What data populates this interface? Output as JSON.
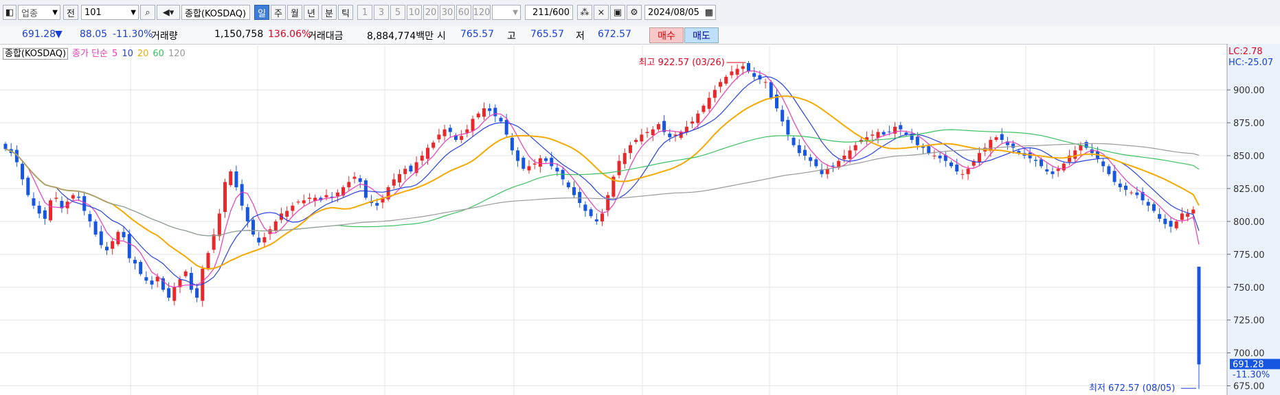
{
  "toolbar": {
    "market_select": "업종",
    "range_label": "전",
    "code_value": "101",
    "index_name": "종합(KOSDAQ)",
    "periods": [
      "일",
      "주",
      "월",
      "년",
      "분",
      "틱"
    ],
    "active_period": "일",
    "minute_units": [
      "1",
      "3",
      "5",
      "10",
      "20",
      "30",
      "60",
      "120"
    ],
    "count_value": "211",
    "count_total": "/600",
    "date_value": "2024/08/05"
  },
  "info": {
    "price": "691.28",
    "change_arrow": "▼",
    "change": "88.05",
    "change_pct": "-11.30%",
    "volume_label": "거래량",
    "volume_value": "1,150,758",
    "volume_ratio": "136.06%",
    "amount_label": "거래대금",
    "amount_value": "8,884,774백만",
    "open_label": "시",
    "open_value": "765.57",
    "high_label": "고",
    "high_value": "765.57",
    "low_label": "저",
    "low_value": "672.57",
    "buy_label": "매수",
    "sell_label": "매도"
  },
  "legend": {
    "name": "종합(KOSDAQ)",
    "ma_label": "종가 단순",
    "ma_periods": [
      "5",
      "10",
      "20",
      "60",
      "120"
    ]
  },
  "colors": {
    "up": "#e8282a",
    "down": "#1756e0",
    "ma5": "#e83ab6",
    "ma10": "#2340e0",
    "ma20": "#f5a800",
    "ma60": "#3cc060",
    "ma120": "#9a9a9a",
    "accent": "#3f7ed8"
  },
  "chart_data": {
    "type": "candlestick",
    "y_ticks": [
      "900.00",
      "875.00",
      "850.00",
      "825.00",
      "800.00",
      "775.00",
      "750.00",
      "725.00",
      "700.00",
      "675.00"
    ],
    "ylim": [
      668,
      935
    ],
    "lc": "LC:2.78",
    "hc": "HC:-25.07",
    "current_price": "691.28",
    "current_pct": "-11.30%",
    "high_annotation": "최고 922.57 (03/26)",
    "low_annotation": "최저 672.57 (08/05)",
    "closes": [
      855,
      852,
      845,
      832,
      820,
      812,
      806,
      802,
      816,
      818,
      810,
      815,
      820,
      818,
      808,
      800,
      790,
      782,
      778,
      785,
      792,
      788,
      772,
      768,
      760,
      755,
      752,
      758,
      748,
      742,
      750,
      756,
      762,
      748,
      742,
      764,
      776,
      790,
      806,
      830,
      838,
      826,
      812,
      800,
      790,
      784,
      788,
      794,
      800,
      806,
      808,
      812,
      815,
      816,
      818,
      818,
      816,
      820,
      818,
      822,
      826,
      830,
      834,
      830,
      818,
      814,
      812,
      818,
      826,
      832,
      836,
      840,
      838,
      845,
      850,
      856,
      860,
      866,
      870,
      868,
      862,
      865,
      870,
      878,
      882,
      886,
      884,
      880,
      876,
      866,
      854,
      846,
      840,
      842,
      844,
      848,
      846,
      842,
      838,
      832,
      826,
      820,
      814,
      808,
      804,
      800,
      806,
      820,
      834,
      846,
      852,
      858,
      862,
      866,
      868,
      870,
      874,
      868,
      864,
      866,
      868,
      872,
      876,
      882,
      888,
      894,
      900,
      906,
      910,
      914,
      916,
      918,
      914,
      910,
      908,
      906,
      894,
      886,
      876,
      866,
      858,
      852,
      850,
      846,
      842,
      836,
      840,
      842,
      846,
      850,
      854,
      858,
      862,
      864,
      866,
      868,
      866,
      868,
      872,
      870,
      866,
      862,
      858,
      856,
      852,
      850,
      848,
      846,
      842,
      838,
      836,
      840,
      846,
      852,
      856,
      862,
      864,
      862,
      858,
      856,
      852,
      850,
      848,
      846,
      842,
      838,
      836,
      840,
      844,
      850,
      854,
      858,
      856,
      852,
      848,
      842,
      836,
      830,
      826,
      824,
      822,
      820,
      816,
      812,
      808,
      802,
      798,
      796,
      800,
      806,
      806,
      809,
      691.28
    ],
    "opens_last": 765.57,
    "high_last": 765.57,
    "low_last": 672.57
  }
}
